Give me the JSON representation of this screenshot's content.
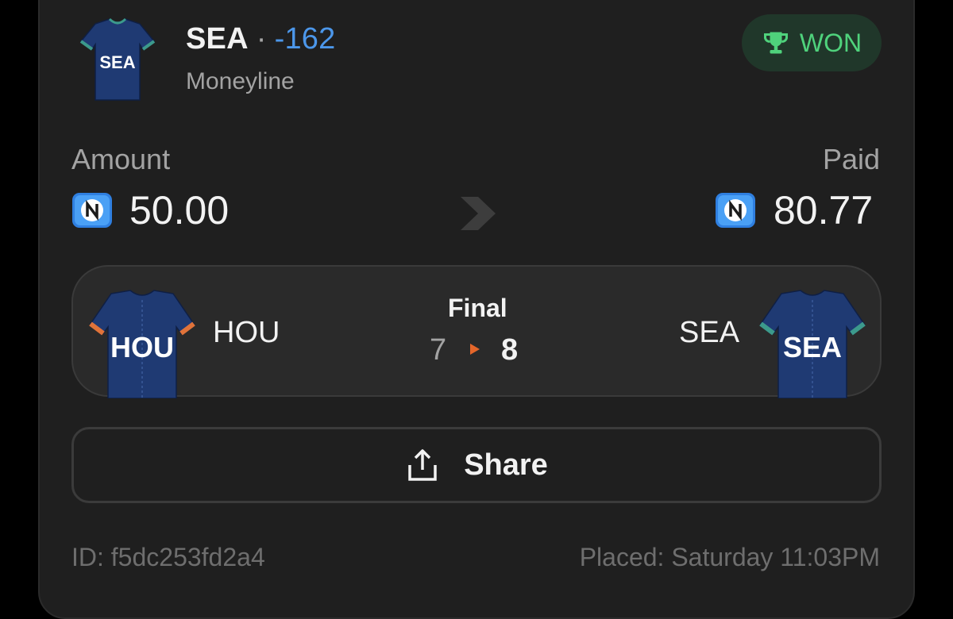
{
  "bet": {
    "team": "SEA",
    "separator": "·",
    "odds": "-162",
    "bet_type": "Moneyline",
    "status": "WON",
    "status_icon": "trophy-icon"
  },
  "amounts": {
    "amount_label": "Amount",
    "amount_value": "50.00",
    "paid_label": "Paid",
    "paid_value": "80.77",
    "currency_icon": "coin-icon"
  },
  "game": {
    "home_team": "HOU",
    "away_team": "SEA",
    "status": "Final",
    "home_score": "7",
    "away_score": "8",
    "home_jersey_text": "HOU",
    "away_jersey_text": "SEA"
  },
  "share": {
    "label": "Share",
    "icon": "share-icon"
  },
  "footer": {
    "id_text": "ID: f5dc253fd2a4",
    "placed_text": "Placed: Saturday 11:03PM"
  },
  "colors": {
    "background": "#000000",
    "card": "#1f1f1f",
    "odds": "#4c97ea",
    "won_bg": "#20372a",
    "won_text": "#4fd27c",
    "jersey_navy": "#1f3a73",
    "hou_accent": "#e0733a",
    "sea_accent": "#3c9a8c",
    "score_arrow": "#e4662a"
  }
}
